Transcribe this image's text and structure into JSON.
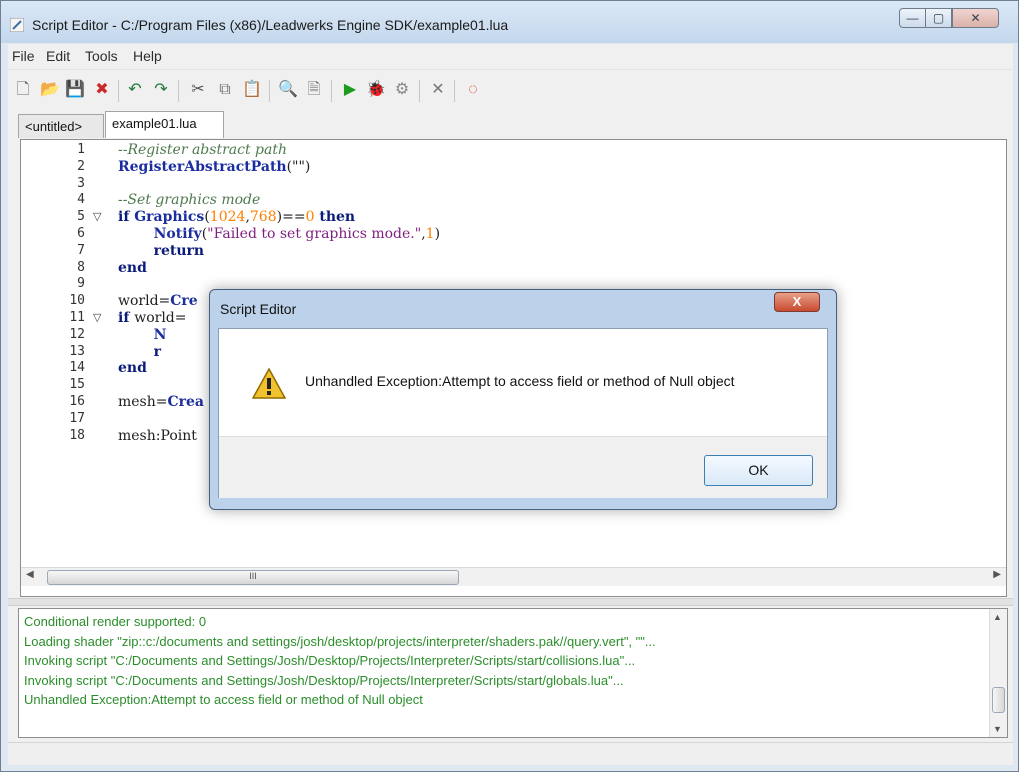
{
  "window": {
    "title": "Script Editor - C:/Program Files (x86)/Leadwerks Engine SDK/example01.lua",
    "controls": [
      "—",
      "▢",
      "✕"
    ]
  },
  "menu": {
    "items": [
      "File",
      "Edit",
      "Tools",
      "Help"
    ]
  },
  "toolbar": {
    "icons": [
      {
        "name": "new-file-icon",
        "glyph": "🗋"
      },
      {
        "name": "open-folder-icon",
        "glyph": "📂"
      },
      {
        "name": "save-icon",
        "glyph": "💾"
      },
      {
        "name": "close-file-icon",
        "glyph": "✖"
      },
      {
        "name": "undo-icon",
        "glyph": "↶"
      },
      {
        "name": "redo-icon",
        "glyph": "↷"
      },
      {
        "name": "cut-icon",
        "glyph": "✂"
      },
      {
        "name": "copy-icon",
        "glyph": "⧉"
      },
      {
        "name": "paste-icon",
        "glyph": "📋"
      },
      {
        "name": "find-icon",
        "glyph": "🔍"
      },
      {
        "name": "goto-icon",
        "glyph": "🗎"
      },
      {
        "name": "run-icon",
        "glyph": "▶"
      },
      {
        "name": "debug-icon",
        "glyph": "🐞"
      },
      {
        "name": "settings-icon",
        "glyph": "⚙"
      },
      {
        "name": "close-icon",
        "glyph": "✕"
      },
      {
        "name": "help-icon",
        "glyph": "◌"
      }
    ]
  },
  "tabs": [
    {
      "label": "<untitled>",
      "active": false
    },
    {
      "label": "example01.lua",
      "active": true
    }
  ],
  "editor": {
    "lines": [
      {
        "n": "1",
        "tokens": [
          {
            "t": "--Register abstract path",
            "c": "c-comment"
          }
        ]
      },
      {
        "n": "2",
        "tokens": [
          {
            "t": "RegisterAbstractPath",
            "c": "c-fn"
          },
          {
            "t": "(\"\")",
            "c": ""
          }
        ]
      },
      {
        "n": "3",
        "tokens": []
      },
      {
        "n": "4",
        "tokens": [
          {
            "t": "--Set graphics mode",
            "c": "c-comment"
          }
        ]
      },
      {
        "n": "5",
        "fold": true,
        "tokens": [
          {
            "t": "if ",
            "c": "c-kw"
          },
          {
            "t": "Graphics",
            "c": "c-fn"
          },
          {
            "t": "(",
            "c": ""
          },
          {
            "t": "1024",
            "c": "c-num"
          },
          {
            "t": ",",
            "c": ""
          },
          {
            "t": "768",
            "c": "c-num"
          },
          {
            "t": ")==",
            "c": ""
          },
          {
            "t": "0",
            "c": "c-num"
          },
          {
            "t": " then",
            "c": "c-kw"
          }
        ]
      },
      {
        "n": "6",
        "tokens": [
          {
            "t": "        ",
            "c": ""
          },
          {
            "t": "Notify",
            "c": "c-fn"
          },
          {
            "t": "(",
            "c": ""
          },
          {
            "t": "\"Failed to set graphics mode.\"",
            "c": "c-str"
          },
          {
            "t": ",",
            "c": ""
          },
          {
            "t": "1",
            "c": "c-num"
          },
          {
            "t": ")",
            "c": ""
          }
        ]
      },
      {
        "n": "7",
        "tokens": [
          {
            "t": "        ",
            "c": ""
          },
          {
            "t": "return",
            "c": "c-kw"
          }
        ]
      },
      {
        "n": "8",
        "tokens": [
          {
            "t": "end",
            "c": "c-kw"
          }
        ]
      },
      {
        "n": "9",
        "tokens": []
      },
      {
        "n": "10",
        "tokens": [
          {
            "t": "world=",
            "c": ""
          },
          {
            "t": "Cre",
            "c": "c-fn"
          }
        ]
      },
      {
        "n": "11",
        "fold": true,
        "tokens": [
          {
            "t": "if ",
            "c": "c-kw"
          },
          {
            "t": "world=",
            "c": ""
          }
        ]
      },
      {
        "n": "12",
        "tokens": [
          {
            "t": "        ",
            "c": ""
          },
          {
            "t": "N",
            "c": "c-fn"
          }
        ]
      },
      {
        "n": "13",
        "tokens": [
          {
            "t": "        ",
            "c": ""
          },
          {
            "t": "r",
            "c": "c-kw"
          }
        ]
      },
      {
        "n": "14",
        "tokens": [
          {
            "t": "end",
            "c": "c-kw"
          }
        ]
      },
      {
        "n": "15",
        "tokens": []
      },
      {
        "n": "16",
        "tokens": [
          {
            "t": "mesh=",
            "c": ""
          },
          {
            "t": "Crea",
            "c": "c-fn"
          }
        ]
      },
      {
        "n": "17",
        "tokens": []
      },
      {
        "n": "18",
        "tokens": [
          {
            "t": "mesh:Point",
            "c": ""
          }
        ]
      }
    ],
    "hscroll_thumb_glyph": "III"
  },
  "console": {
    "lines": [
      "Conditional render supported: 0",
      "Loading shader \"zip::c:/documents and settings/josh/desktop/projects/interpreter/shaders.pak//query.vert\", \"\"...",
      "Invoking script \"C:/Documents and Settings/Josh/Desktop/Projects/Interpreter/Scripts/start/collisions.lua\"...",
      "Invoking script \"C:/Documents and Settings/Josh/Desktop/Projects/Interpreter/Scripts/start/globals.lua\"...",
      "Unhandled Exception:Attempt to access field or method of Null object"
    ]
  },
  "dialog": {
    "title": "Script Editor",
    "message": "Unhandled Exception:Attempt to access field or method of Null object",
    "ok_label": "OK",
    "close_glyph": "X"
  },
  "colors": {
    "console_text": "#2b8e2b",
    "comment": "#4f7a4f",
    "keyword": "#0b1b79",
    "number": "#ff7f00",
    "string": "#7e1e7e"
  }
}
